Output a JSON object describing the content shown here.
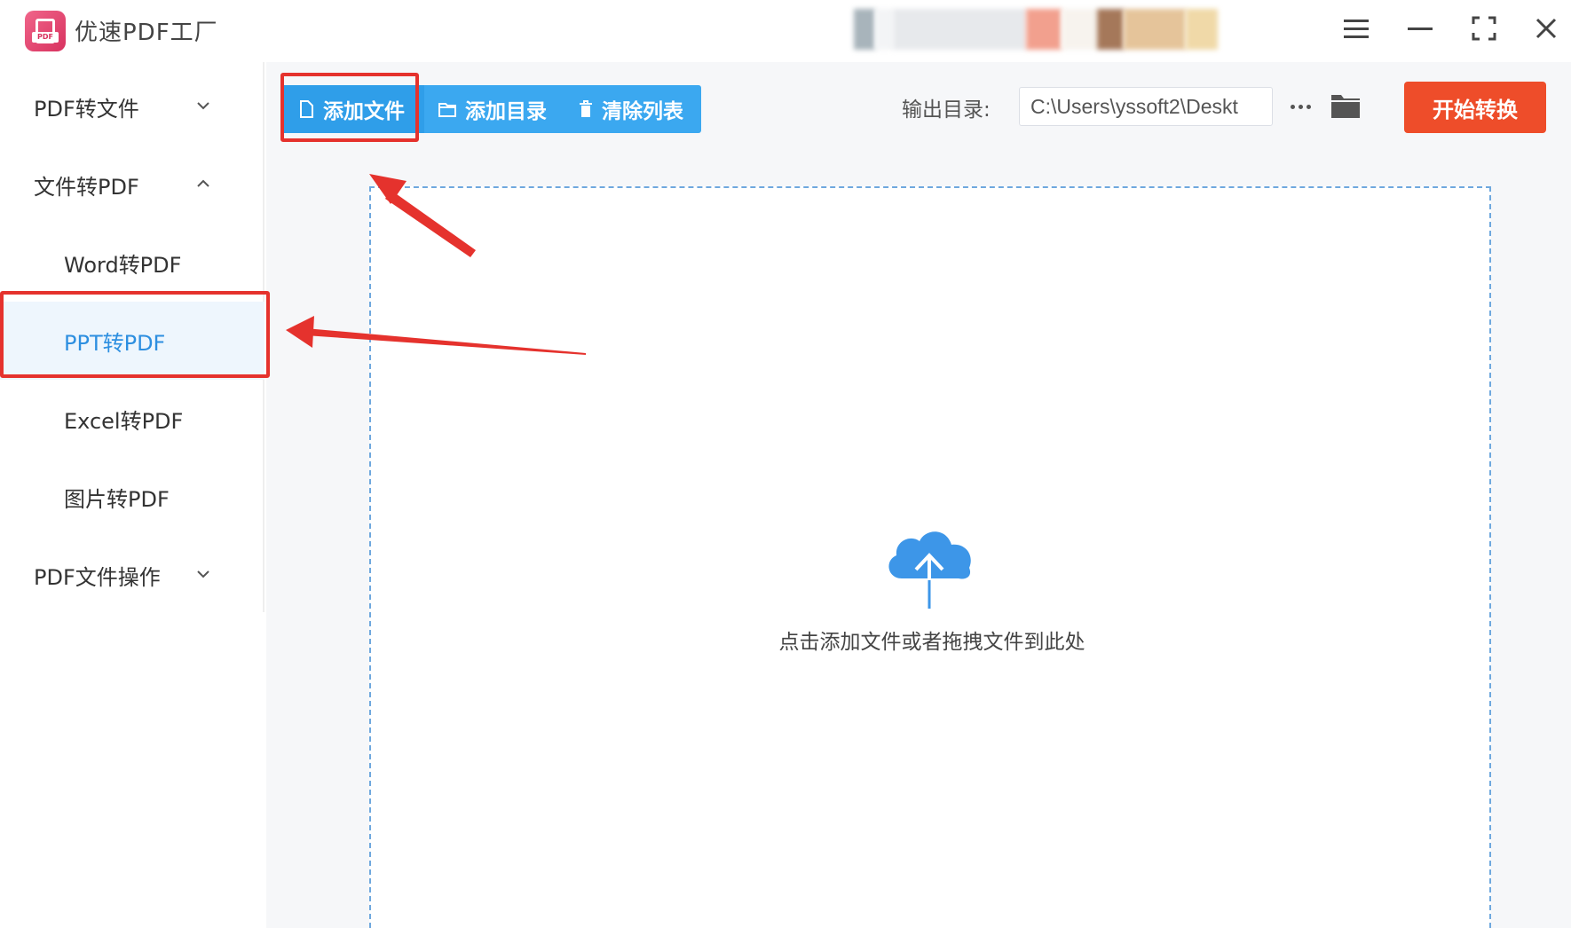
{
  "app": {
    "title": "优速PDF工厂",
    "logo_icon": "pdf-logo-icon",
    "logo_tag": "PDF"
  },
  "window_controls": [
    {
      "name": "menu-icon"
    },
    {
      "name": "minimize-icon"
    },
    {
      "name": "maximize-icon"
    },
    {
      "name": "close-icon"
    }
  ],
  "sidebar": {
    "groups": [
      {
        "label": "PDF转文件",
        "expanded": false
      },
      {
        "label": "文件转PDF",
        "expanded": true
      },
      {
        "label": "PDF文件操作",
        "expanded": false
      }
    ],
    "sub_items": [
      {
        "label": "Word转PDF"
      },
      {
        "label": "PPT转PDF",
        "active": true
      },
      {
        "label": "Excel转PDF"
      },
      {
        "label": "图片转PDF"
      }
    ]
  },
  "toolbar": {
    "add_file": "添加文件",
    "add_dir": "添加目录",
    "clear_list": "清除列表",
    "output_label": "输出目录:",
    "output_path": "C:\\Users\\yssoft2\\Deskt",
    "start": "开始转换"
  },
  "dropzone": {
    "icon": "cloud-upload-icon",
    "text": "点击添加文件或者拖拽文件到此处"
  },
  "colors": {
    "accent_blue": "#3ba8f0",
    "active_text": "#2d8fe0",
    "start_orange": "#ee4d2a",
    "annotation_red": "#e5322d",
    "logo_pink": "#e44a74"
  }
}
